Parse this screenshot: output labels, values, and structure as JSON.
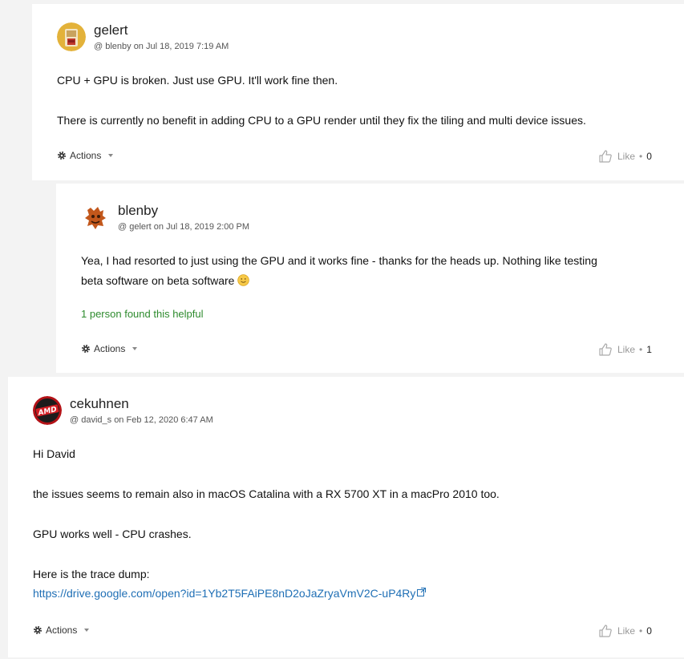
{
  "posts": [
    {
      "author": "gelert",
      "meta": "@ blenby on Jul 18, 2019 7:19 AM",
      "paragraphs": [
        "CPU + GPU is broken. Just use GPU. It'll work fine then.",
        "There is currently no benefit in adding CPU to a GPU render until they fix the tiling and multi device issues."
      ],
      "actions_label": "Actions",
      "like_label": "Like",
      "like_count": "0"
    },
    {
      "author": "blenby",
      "meta": "@ gelert on Jul 18, 2019 2:00 PM",
      "paragraphs": [
        "Yea, I had resorted to just using the GPU and it works fine - thanks for the heads up. Nothing like testing",
        "beta software on beta software"
      ],
      "helpful_text": "1 person found this helpful",
      "actions_label": "Actions",
      "like_label": "Like",
      "like_count": "1"
    },
    {
      "author": "cekuhnen",
      "meta": "@ david_s on Feb 12, 2020 6:47 AM",
      "paragraphs": [
        "Hi David",
        "the issues seems to remain also in macOS Catalina with a RX 5700 XT in a macPro 2010 too.",
        "GPU works well - CPU crashes.",
        "Here is the trace dump:"
      ],
      "link_text": "https://drive.google.com/open?id=1Yb2T5FAiPE8nD2oJaZryaVmV2C-uP4Ry",
      "avatar_text": "AMD",
      "actions_label": "Actions",
      "like_label": "Like",
      "like_count": "0"
    }
  ],
  "icons": {
    "actions": "gear-icon",
    "like": "thumbs-up-icon",
    "external": "external-link-icon",
    "smiley": "smiley-emoji-icon"
  },
  "colors": {
    "helpful": "#2e8b2e",
    "link": "#1f6fb5"
  }
}
